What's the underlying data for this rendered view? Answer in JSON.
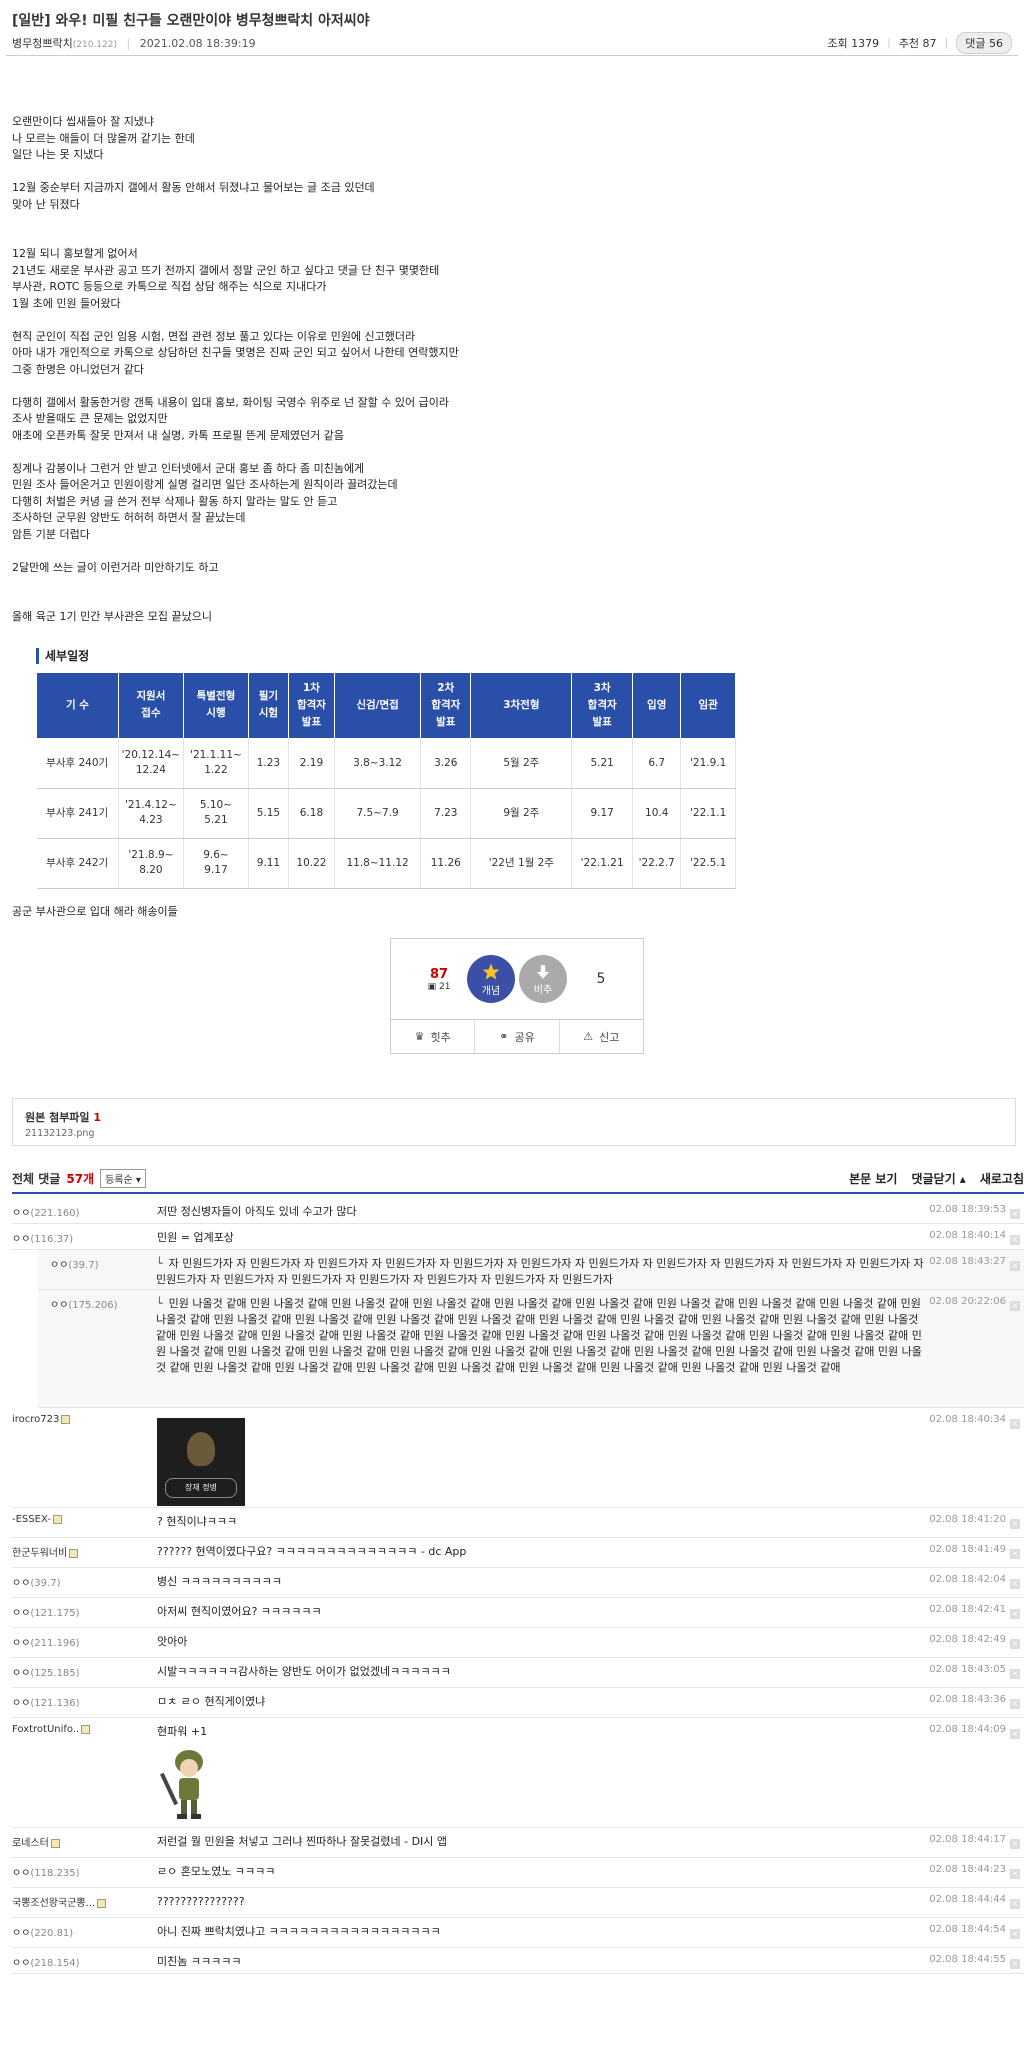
{
  "post": {
    "title": "[일반] 와우! 미필 친구들 오랜만이야 병무청쁘락치 아저씨야",
    "author": "병무청쁘락치",
    "author_ip": "(210.122)",
    "date": "2021.02.08 18:39:19",
    "views": "조회 1379",
    "recommends": "추천 87",
    "replies": "댓글 56"
  },
  "body_lines": [
    "오랜만이다 씹새들아 잘 지냈냐",
    "나 모르는 애들이 더 많을꺼 같기는 한데",
    "일단 나는 못 지냈다",
    "",
    "12월 중순부터 지금까지 갤에서 활동 안해서 뒤졌냐고 물어보는 글 조금 있던데",
    "맞아 난 뒤졌다",
    "",
    "",
    "12월 되니 홍보할게 없어서",
    "21년도 새로운 부사관 공고 뜨기 전까지 갤에서 정말 군인 하고 싶다고 댓글 단 친구 몇몇한테",
    "부사관, ROTC 등등으로 카톡으로 직접 상담 해주는 식으로 지내다가",
    "1월 초에 민원 들어왔다",
    "",
    "현직 군인이 직접 군인 임용 시험, 면접 관련 정보 풀고 있다는 이유로 민원에 신고했더라",
    "아마 내가 개인적으로 카톡으로 상담하던 친구들 몇명은 진짜 군인 되고 싶어서 나한테 연락했지만",
    "그중 한명은 아니었던거 같다",
    "",
    "다행히 갤에서 활동한거랑 갠톡 내용이 입대 홍보, 화이팅 국영수 위주로 넌 잘할 수 있어 급이라",
    "조사 받을때도 큰 문제는 없었지만",
    "애초에 오픈카톡 잘못 만져서 내 실명, 카톡 프로필 뜬게 문제였던거 같음",
    "",
    "징계나 감봉이나 그런거 안 받고 인터넷에서 군대 홍보 좀 하다 좀 미친놈에게",
    "민원 조사 들어온거고 민원이랑게 실명 걸리면 일단 조사하는게 원칙이라 끌려갔는데",
    "다행히 처벌은 커녕 글 쓴거 전부 삭제나 활동 하지 말라는 말도 안 듣고",
    "조사하던 군무원 양반도 허허허 하면서 잘 끝났는데",
    "암튼 기분 더럽다",
    "",
    "2달만에 쓰는 글이 이런거라 미안하기도 하고",
    "",
    "",
    "올해 육군 1기 민간 부사관은 모집 끝났으니"
  ],
  "table": {
    "title": "세부일정",
    "headers": [
      "기 수",
      "지원서\n접수",
      "특별전형\n시행",
      "필기\n시험",
      "1차\n합격자\n발표",
      "신검/면접",
      "2차\n합격자\n발표",
      "3차전형",
      "3차\n합격자\n발표",
      "입영",
      "임관"
    ],
    "rows": [
      [
        "부사후 240기",
        "'20.12.14~\n12.24",
        "'21.1.11~\n1.22",
        "1.23",
        "2.19",
        "3.8~3.12",
        "3.26",
        "5월 2주",
        "5.21",
        "6.7",
        "'21.9.1"
      ],
      [
        "부사후 241기",
        "'21.4.12~\n4.23",
        "5.10~\n5.21",
        "5.15",
        "6.18",
        "7.5~7.9",
        "7.23",
        "9월 2주",
        "9.17",
        "10.4",
        "'22.1.1"
      ],
      [
        "부사후 242기",
        "'21.8.9~\n8.20",
        "9.6~\n9.17",
        "9.11",
        "10.22",
        "11.8~11.12",
        "11.26",
        "'22년 1월 2주",
        "'22.1.21",
        "'22.2.7",
        "'22.5.1"
      ]
    ]
  },
  "after_table": "공군 부사관으로 입대 해라 해송이들",
  "vote": {
    "up_count": "87",
    "fixed_count": "21",
    "up_label": "개념",
    "down_label": "비추",
    "down_count": "5",
    "hit_label": "힛추",
    "share_label": "공유",
    "report_label": "신고"
  },
  "attachment": {
    "title": "원본 첨부파일",
    "count": "1",
    "file": "21132123.png"
  },
  "comment_header": {
    "label": "전체 댓글",
    "count": "57개",
    "sort": "등록순",
    "view_body": "본문 보기",
    "close_comments": "댓글닫기",
    "refresh": "새로고침"
  },
  "comments": [
    {
      "nick": "ㅇㅇ",
      "ip": "(221.160)",
      "text": "저딴 정신병자들이 아직도 있네 수고가 많다",
      "date": "02.08 18:39:53"
    },
    {
      "nick": "ㅇㅇ",
      "ip": "(116.37)",
      "text": "민원 = 업계포상",
      "date": "02.08 18:40:14"
    }
  ],
  "replies": [
    {
      "nick": "ㅇㅇ",
      "ip": "(39.7)",
      "text": "자 민원드가자 자 민원드가자 자 민원드가자 자 민원드가자 자 민원드가자 자 민원드가자 자 민원드가자 자 민원드가자 자 민원드가자 자 민원드가자 자 민원드가자 자 민원드가자 자 민원드가자 자 민원드가자 자 민원드가자 자 민원드가자 자 민원드가자 자 민원드가자",
      "date": "02.08 18:43:27"
    },
    {
      "nick": "ㅇㅇ",
      "ip": "(175.206)",
      "text": "민원 나올것 같애 민원 나올것 같애 민원 나올것 같애 민원 나올것 같애 민원 나올것 같애 민원 나올것 같애 민원 나올것 같애 민원 나올것 같애 민원 나올것 같애 민원 나올것 같애 민원 나올것 같애 민원 나올것 같애 민원 나올것 같애 민원 나올것 같애 민원 나올것 같애 민원 나올것 같애 민원 나올것 같애 민원 나올것 같애 민원 나올것 같애 민원 나올것 같애 민원 나올것 같애 민원 나올것 같애 민원 나올것 같애 민원 나올것 같애 민원 나올것 같애 민원 나올것 같애 민원 나올것 같애 민원 나올것 같애 민원 나올것 같애 민원 나올것 같애 민원 나올것 같애 민원 나올것 같애 민원 나올것 같애 민원 나올것 같애 민원 나올것 같애 민원 나올것 같애 민원 나올것 같애 민원 나올것 같애 민원 나올것 같애 민원 나올것 같애 민원 나올것 같애 민원 나올것 같애 민원 나올것 같애 민원 나올것 같애 민원 나올것 같애 민원 나올것 같애",
      "date": "02.08 20:22:06"
    }
  ],
  "comments2": [
    {
      "nick": "irocro723",
      "ip": "",
      "text": "",
      "date": "02.08 18:40:34",
      "image": "장재 정병"
    },
    {
      "nick": "-ESSEX-",
      "ip": "",
      "text": "? 현직이냐ㅋㅋㅋ",
      "date": "02.08 18:41:20"
    },
    {
      "nick": "한군두워너비",
      "ip": "",
      "text": "?????? 현역이였다구요? ㅋㅋㅋㅋㅋㅋㅋㅋㅋㅋㅋㅋㅋㅋ - dc App",
      "date": "02.08 18:41:49"
    },
    {
      "nick": "ㅇㅇ",
      "ip": "(39.7)",
      "text": "병신 ㅋㅋㅋㅋㅋㅋㅋㅋㅋㅋ",
      "date": "02.08 18:42:04"
    },
    {
      "nick": "ㅇㅇ",
      "ip": "(121.175)",
      "text": "아저씨 현직이였어요? ㅋㅋㅋㅋㅋㅋ",
      "date": "02.08 18:42:41"
    },
    {
      "nick": "ㅇㅇ",
      "ip": "(211.196)",
      "text": "앗아아",
      "date": "02.08 18:42:49"
    },
    {
      "nick": "ㅇㅇ",
      "ip": "(125.185)",
      "text": "시발ㅋㅋㅋㅋㅋㅋ감사하는 양반도 어이가 없었겠네ㅋㅋㅋㅋㅋㅋ",
      "date": "02.08 18:43:05"
    },
    {
      "nick": "ㅇㅇ",
      "ip": "(121.136)",
      "text": "ㅁㅊ ㄹㅇ 현직게이였냐",
      "date": "02.08 18:43:36"
    },
    {
      "nick": "FoxtrotUnifo..",
      "ip": "",
      "text": "현파워 +1",
      "date": "02.08 18:44:09",
      "image": "soldier"
    },
    {
      "nick": "로네스터",
      "ip": "",
      "text": "저런걸 뭘 민원을 처넣고 그러냐 찐따하나 잘못걸렸네 - DI시 앱",
      "date": "02.08 18:44:17"
    },
    {
      "nick": "ㅇㅇ",
      "ip": "(118.235)",
      "text": "ㄹㅇ 혼모노였노 ㅋㅋㅋㅋ",
      "date": "02.08 18:44:23"
    },
    {
      "nick": "국뽕조선왕국군뽕...",
      "ip": "",
      "text": "???????????????",
      "date": "02.08 18:44:44"
    },
    {
      "nick": "ㅇㅇ",
      "ip": "(220.81)",
      "text": "아니 진짜 쁘락치였냐고 ㅋㅋㅋㅋㅋㅋㅋㅋㅋㅋㅋㅋㅋㅋㅋㅋㅋ",
      "date": "02.08 18:44:54"
    },
    {
      "nick": "ㅇㅇ",
      "ip": "(218.154)",
      "text": "미친놈 ㅋㅋㅋㅋㅋ",
      "date": "02.08 18:44:55"
    }
  ]
}
